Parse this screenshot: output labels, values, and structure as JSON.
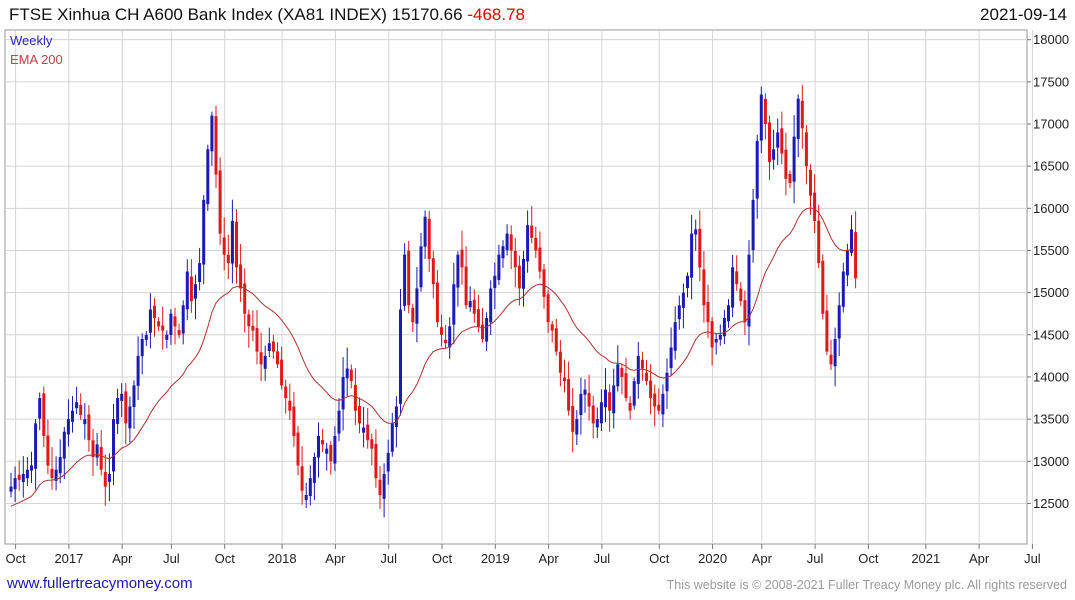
{
  "header": {
    "title": "FTSE Xinhua CH A600 Bank Index (XA81 INDEX) 15170.66",
    "change": "-468.78",
    "date": "2021-09-14"
  },
  "footer": {
    "site": "www.fullertreacymoney.com",
    "copyright": "This website is © 2008-2021 Fuller Treacy Money plc. All rights reserved"
  },
  "colors": {
    "up": "#1a1ab5",
    "down": "#e01818",
    "ema": "#b03030",
    "grid": "#d4d4d4"
  },
  "chart_data": {
    "type": "candlestick",
    "frequency_label": "Weekly",
    "legend": [
      "Weekly",
      "EMA 200"
    ],
    "legend_placement": "top-left",
    "grid": true,
    "ylim": [
      12000,
      18100
    ],
    "yticks": [
      12500,
      13000,
      13500,
      14000,
      14500,
      15000,
      15500,
      16000,
      16500,
      17000,
      17500,
      18000
    ],
    "xticks": [
      {
        "label": "Oct",
        "week": 1
      },
      {
        "label": "2017",
        "week": 14
      },
      {
        "label": "Apr",
        "week": 27
      },
      {
        "label": "Jul",
        "week": 39
      },
      {
        "label": "Oct",
        "week": 52
      },
      {
        "label": "2018",
        "week": 66
      },
      {
        "label": "Apr",
        "week": 79
      },
      {
        "label": "Jul",
        "week": 92
      },
      {
        "label": "Oct",
        "week": 105
      },
      {
        "label": "2019",
        "week": 118
      },
      {
        "label": "Apr",
        "week": 131
      },
      {
        "label": "Jul",
        "week": 144
      },
      {
        "label": "Oct",
        "week": 158
      },
      {
        "label": "2020",
        "week": 171
      },
      {
        "label": "Apr",
        "week": 183
      },
      {
        "label": "Jul",
        "week": 196
      },
      {
        "label": "Oct",
        "week": 209
      },
      {
        "label": "2021",
        "week": 223
      },
      {
        "label": "Apr",
        "week": 236
      },
      {
        "label": "Jul",
        "week": 249
      }
    ],
    "series_close": [
      12700,
      12800,
      12780,
      12850,
      12900,
      12950,
      13450,
      13750,
      13300,
      12950,
      12800,
      12900,
      13050,
      13350,
      13500,
      13600,
      13700,
      13550,
      13500,
      13250,
      13050,
      13200,
      12900,
      12700,
      12850,
      13500,
      13750,
      13800,
      13450,
      13650,
      13900,
      14250,
      14450,
      14500,
      14800,
      14700,
      14600,
      14550,
      14500,
      14750,
      14600,
      14500,
      14850,
      15250,
      14900,
      15100,
      15350,
      16100,
      16700,
      17100,
      16400,
      15700,
      15450,
      15350,
      15850,
      15300,
      15050,
      14750,
      14600,
      14550,
      14300,
      14150,
      14250,
      14400,
      14300,
      14150,
      13900,
      13750,
      13600,
      13300,
      12950,
      12650,
      12600,
      12800,
      13050,
      13300,
      13200,
      13150,
      13000,
      13300,
      13600,
      14000,
      14100,
      13950,
      13600,
      13450,
      13400,
      13250,
      13150,
      12800,
      12600,
      12850,
      13100,
      13450,
      13650,
      14800,
      15450,
      14850,
      14650,
      15050,
      15550,
      15900,
      15400,
      15100,
      14650,
      14500,
      14400,
      14600,
      15100,
      15450,
      15300,
      14850,
      14900,
      14750,
      14600,
      14450,
      14700,
      15050,
      15200,
      15450,
      15550,
      15700,
      15500,
      15300,
      15050,
      15400,
      15800,
      15650,
      15500,
      15250,
      14950,
      14650,
      14550,
      14300,
      14050,
      13950,
      13600,
      13350,
      13500,
      13800,
      13850,
      13650,
      13450,
      13500,
      13700,
      13850,
      13600,
      13900,
      14150,
      14000,
      13750,
      13600,
      13950,
      14250,
      14100,
      13950,
      13750,
      13650,
      13600,
      13800,
      14050,
      14350,
      14650,
      14850,
      15000,
      15200,
      15700,
      15750,
      15300,
      14850,
      14650,
      14350,
      14450,
      14500,
      14700,
      14850,
      15300,
      15100,
      14900,
      14650,
      15450,
      16100,
      16800,
      17350,
      17000,
      16550,
      16700,
      16900,
      16650,
      16350,
      16300,
      16850,
      17300,
      16950,
      16500,
      16150,
      15850,
      15350,
      14750,
      14300,
      14150,
      14450,
      14850,
      15250,
      15500,
      15750,
      15170
    ]
  }
}
